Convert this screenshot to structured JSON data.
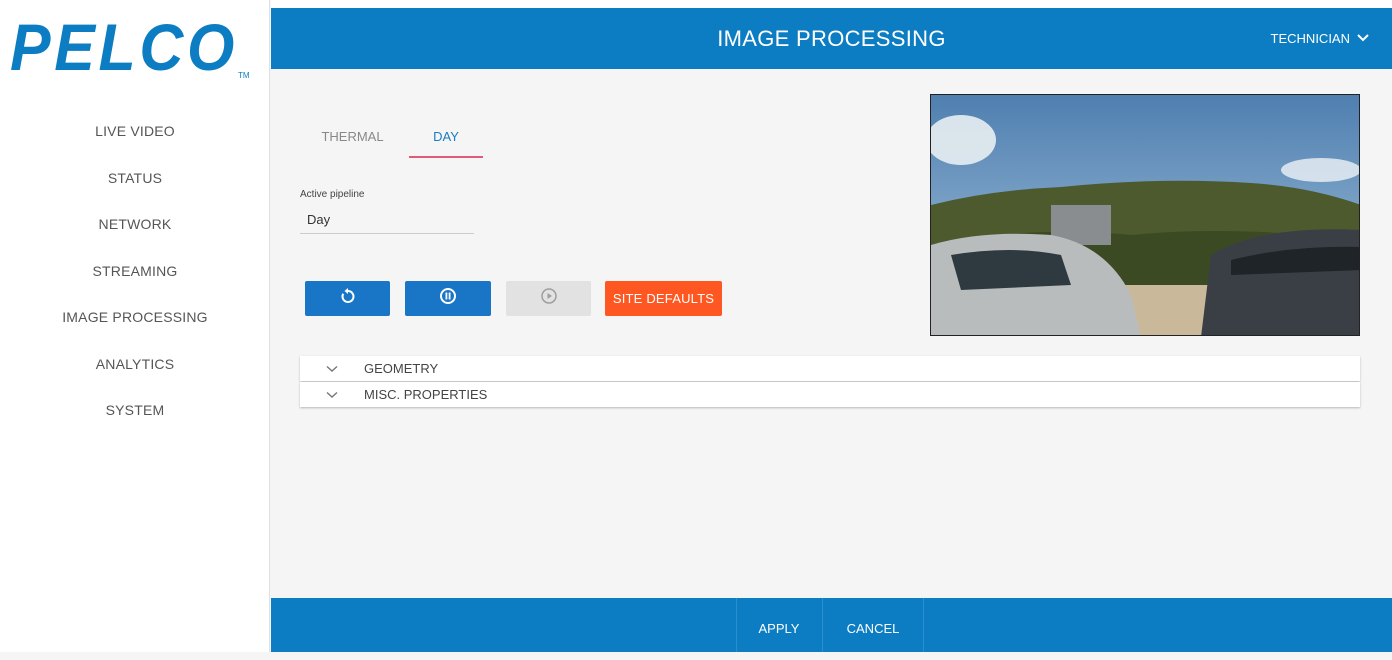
{
  "brand": {
    "name": "PELCO",
    "trademark": "TM",
    "color": "#0c7dc2"
  },
  "nav": {
    "items": [
      {
        "label": "LIVE VIDEO"
      },
      {
        "label": "STATUS"
      },
      {
        "label": "NETWORK"
      },
      {
        "label": "STREAMING"
      },
      {
        "label": "IMAGE PROCESSING"
      },
      {
        "label": "ANALYTICS"
      },
      {
        "label": "SYSTEM"
      }
    ]
  },
  "header": {
    "title": "IMAGE PROCESSING",
    "user": "TECHNICIAN",
    "user_icon": "chevron-down-icon"
  },
  "tabs": [
    {
      "label": "THERMAL",
      "active": false
    },
    {
      "label": "DAY",
      "active": true
    }
  ],
  "pipeline": {
    "label": "Active pipeline",
    "value": "Day"
  },
  "controls": {
    "reset_icon": "reset-icon",
    "pause_icon": "pause-icon",
    "play_icon": "play-icon",
    "site_defaults_label": "SITE DEFAULTS"
  },
  "sections": [
    {
      "label": "GEOMETRY"
    },
    {
      "label": "MISC. PROPERTIES"
    }
  ],
  "footer": {
    "apply_label": "APPLY",
    "cancel_label": "CANCEL"
  },
  "colors": {
    "accent": "#0c7dc2",
    "button_blue": "#1976c7",
    "site_defaults": "#ff5722",
    "tab_underline": "#e05a7a"
  }
}
